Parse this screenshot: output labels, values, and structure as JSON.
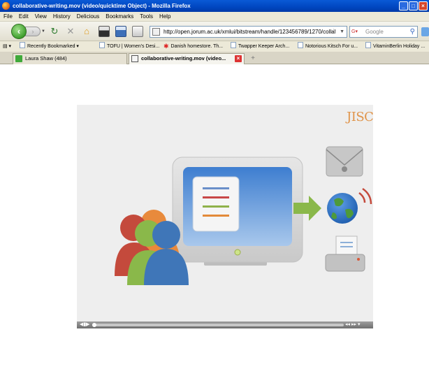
{
  "window": {
    "title": "collaborative-writing.mov (video/quicktime Object) - Mozilla Firefox"
  },
  "menu": [
    "File",
    "Edit",
    "View",
    "History",
    "Delicious",
    "Bookmarks",
    "Tools",
    "Help"
  ],
  "nav": {
    "url": "http://open.jorum.ac.uk/xmlui/bitstream/handle/123456789/1270/collal",
    "search_placeholder": "Google"
  },
  "bookmarks": [
    "Recently Bookmarked",
    "TOFU | Women's Desi...",
    "Danish homestore. Th...",
    "Twapper Keeper Arch...",
    "Notorious Kitsch For u...",
    "VitaminBerlin Holiday ..."
  ],
  "tabs": [
    {
      "label": "Laura Shaw (484)"
    },
    {
      "label": "collaborative-writing.mov (video..."
    }
  ],
  "video": {
    "logo": "JISC"
  },
  "colors": {
    "titlebar": "#0046c0",
    "accent_orange": "#e0944a",
    "arrow_green": "#7cb342"
  },
  "icons": [
    "back-arrow-icon",
    "forward-arrow-icon",
    "reload-icon",
    "stop-icon",
    "home-icon",
    "star-icon",
    "search-icon",
    "close-icon",
    "envelope-icon",
    "globe-icon",
    "printer-icon"
  ]
}
